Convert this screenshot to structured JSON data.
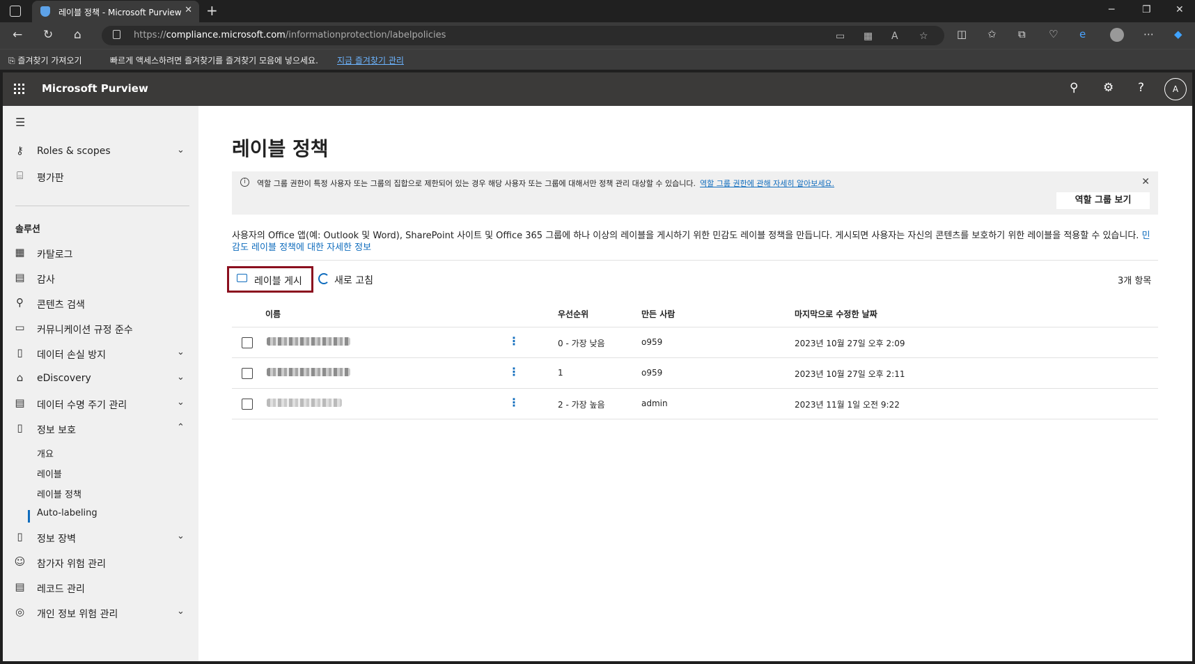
{
  "browser": {
    "tab_title": "레이블 정책 - Microsoft Purview",
    "url_prefix": "https://",
    "url_domain": "compliance.microsoft.com",
    "url_path": "/informationprotection/labelpolicies",
    "favorites_import": "즐겨찾기 가져오기",
    "favorites_hint": "빠르게 액세스하려면 즐겨찾기를 즐겨찾기 모음에 넣으세요.",
    "favorites_manage": "지금 즐겨찾기 관리"
  },
  "suite": {
    "brand": "Microsoft Purview",
    "avatar_initial": "A"
  },
  "sidebar": {
    "items": [
      {
        "label": "Roles & scopes",
        "icon": "key-icon"
      },
      {
        "label": "평가판",
        "icon": "gift-icon"
      }
    ],
    "section_label": "솔루션",
    "solutions": [
      {
        "label": "카탈로그",
        "icon": "catalog-icon"
      },
      {
        "label": "감사",
        "icon": "audit-icon"
      },
      {
        "label": "콘텐츠 검색",
        "icon": "search-icon"
      },
      {
        "label": "커뮤니케이션 규정 준수",
        "icon": "chat-icon"
      },
      {
        "label": "데이터 손실 방지",
        "icon": "shield-doc-icon"
      },
      {
        "label": "eDiscovery",
        "icon": "ediscovery-icon"
      },
      {
        "label": "데이터 수명 주기 관리",
        "icon": "lifecycle-icon"
      },
      {
        "label": "정보 보호",
        "icon": "lock-doc-icon"
      }
    ],
    "info_protection_sub": [
      "개요",
      "레이블",
      "레이블 정책",
      "Auto-labeling"
    ],
    "more": [
      {
        "label": "정보 장벽",
        "icon": "barrier-icon"
      },
      {
        "label": "참가자 위험 관리",
        "icon": "person-risk-icon"
      },
      {
        "label": "레코드 관리",
        "icon": "records-icon"
      },
      {
        "label": "개인 정보 위험 관리",
        "icon": "fingerprint-icon"
      }
    ]
  },
  "main": {
    "title": "레이블 정책",
    "banner_text": "역할 그룹 권한이 특정 사용자 또는 그룹의 집합으로 제한되어 있는 경우 해당 사용자 또는 그룹에 대해서만 정책 관리 대상할 수 있습니다.",
    "banner_link": "역할 그룹 권한에 관해 자세히 알아보세요.",
    "banner_button": "역할 그룹 보기",
    "description": "사용자의 Office 앱(예: Outlook 및 Word), SharePoint 사이트 및 Office 365 그룹에 하나 이상의 레이블을 게시하기 위한 민감도 레이블 정책을 만듭니다. 게시되면 사용자는 자신의 콘텐츠를 보호하기 위한 레이블을 적용할 수 있습니다.",
    "description_link": "민감도 레이블 정책에 대한 자세한 정보",
    "publish_label": "레이블 게시",
    "refresh_label": "새로 고침",
    "item_count": "3개 항목",
    "columns": {
      "name": "이름",
      "priority": "우선순위",
      "created_by": "만든 사람",
      "modified": "마지막으로 수정한 날짜"
    },
    "rows": [
      {
        "priority": "0 - 가장 낮음",
        "created_by": "o959",
        "modified": "2023년 10월 27일 오후 2:09"
      },
      {
        "priority": "1",
        "created_by": "o959",
        "modified": "2023년 10월 27일 오후 2:11"
      },
      {
        "priority": "2 - 가장 높음",
        "created_by": "admin",
        "modified": "2023년 11월 1일 오전 9:22"
      }
    ]
  }
}
